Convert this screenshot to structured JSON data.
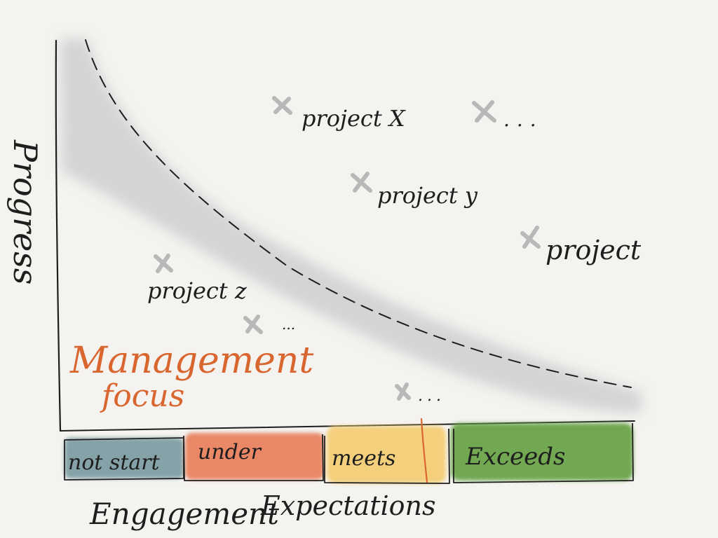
{
  "diagram": {
    "y_axis_label": "Progress",
    "x_axis_labels": {
      "left": "Engagement",
      "right": "Expectations"
    },
    "focus_label": {
      "line1": "Management",
      "line2": "focus"
    },
    "colors": {
      "background": "#f4f3f0",
      "ink": "#1e1e1e",
      "cross": "#b8b8b8",
      "shade": "#c9cacc",
      "focus": "#d9662f"
    },
    "projects": [
      {
        "label": "project X"
      },
      {
        "label": "..."
      },
      {
        "label": "project y"
      },
      {
        "label": "project"
      },
      {
        "label": "project z"
      },
      {
        "label": "..."
      },
      {
        "label": "..."
      }
    ],
    "segments": [
      {
        "label": "not start",
        "color": "#7f9ea4"
      },
      {
        "label": "under",
        "color": "#e9825e"
      },
      {
        "label": "meets",
        "color": "#f5cf77"
      },
      {
        "label": "Exceeds",
        "color": "#6aa448"
      }
    ]
  }
}
